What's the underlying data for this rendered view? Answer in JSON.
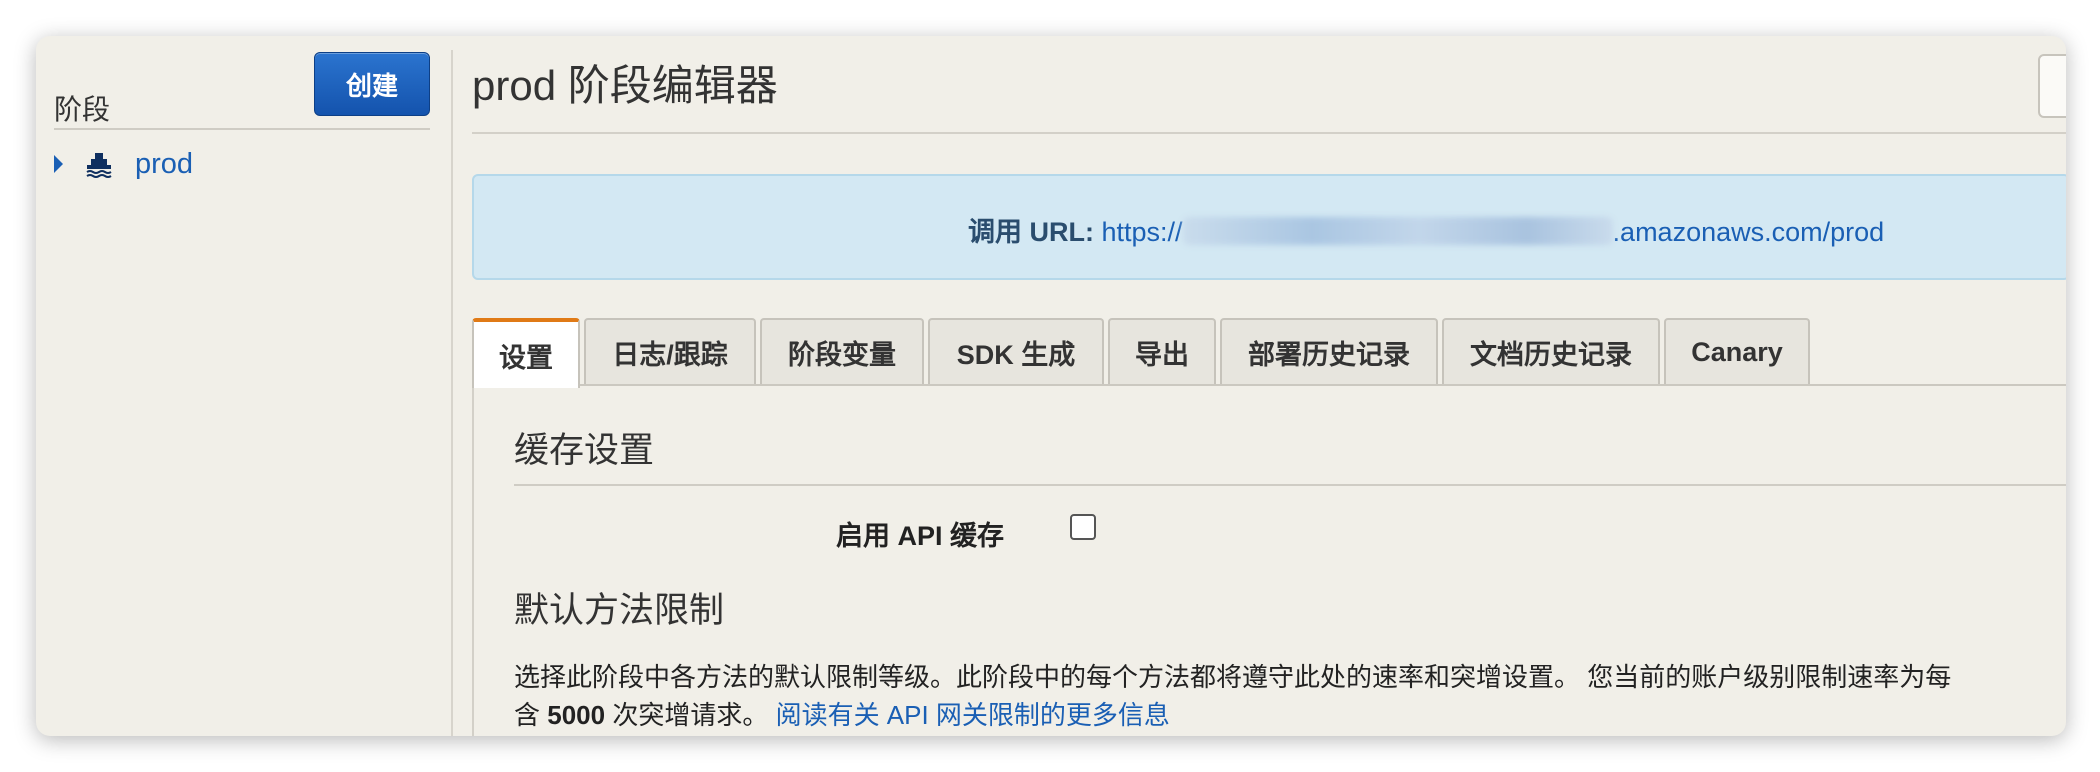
{
  "sidebar": {
    "title": "阶段",
    "create_label": "创建",
    "items": [
      {
        "label": "prod"
      }
    ]
  },
  "header": {
    "title": "prod 阶段编辑器"
  },
  "invoke_url": {
    "label": "调用 URL:",
    "prefix": "https://",
    "suffix": ".amazonaws.com/prod"
  },
  "tabs": [
    {
      "label": "设置",
      "active": true
    },
    {
      "label": "日志/跟踪"
    },
    {
      "label": "阶段变量"
    },
    {
      "label": "SDK 生成"
    },
    {
      "label": "导出"
    },
    {
      "label": "部署历史记录"
    },
    {
      "label": "文档历史记录"
    },
    {
      "label": "Canary"
    }
  ],
  "cache": {
    "heading": "缓存设置",
    "enable_label": "启用 API 缓存",
    "enabled": false
  },
  "throttling": {
    "heading": "默认方法限制",
    "desc_line1": "选择此阶段中各方法的默认限制等级。此阶段中的每个方法都将遵守此处的速率和突增设置。 您当前的账户级别限制速率为每",
    "desc_line2_pre": "含",
    "burst_value": "5000",
    "desc_line2_post": "次突增请求。",
    "link": "阅读有关 API 网关限制的更多信息"
  },
  "colors": {
    "accent": "#e07a16",
    "primary": "#1a5fb4",
    "banner": "#d3e8f3"
  }
}
